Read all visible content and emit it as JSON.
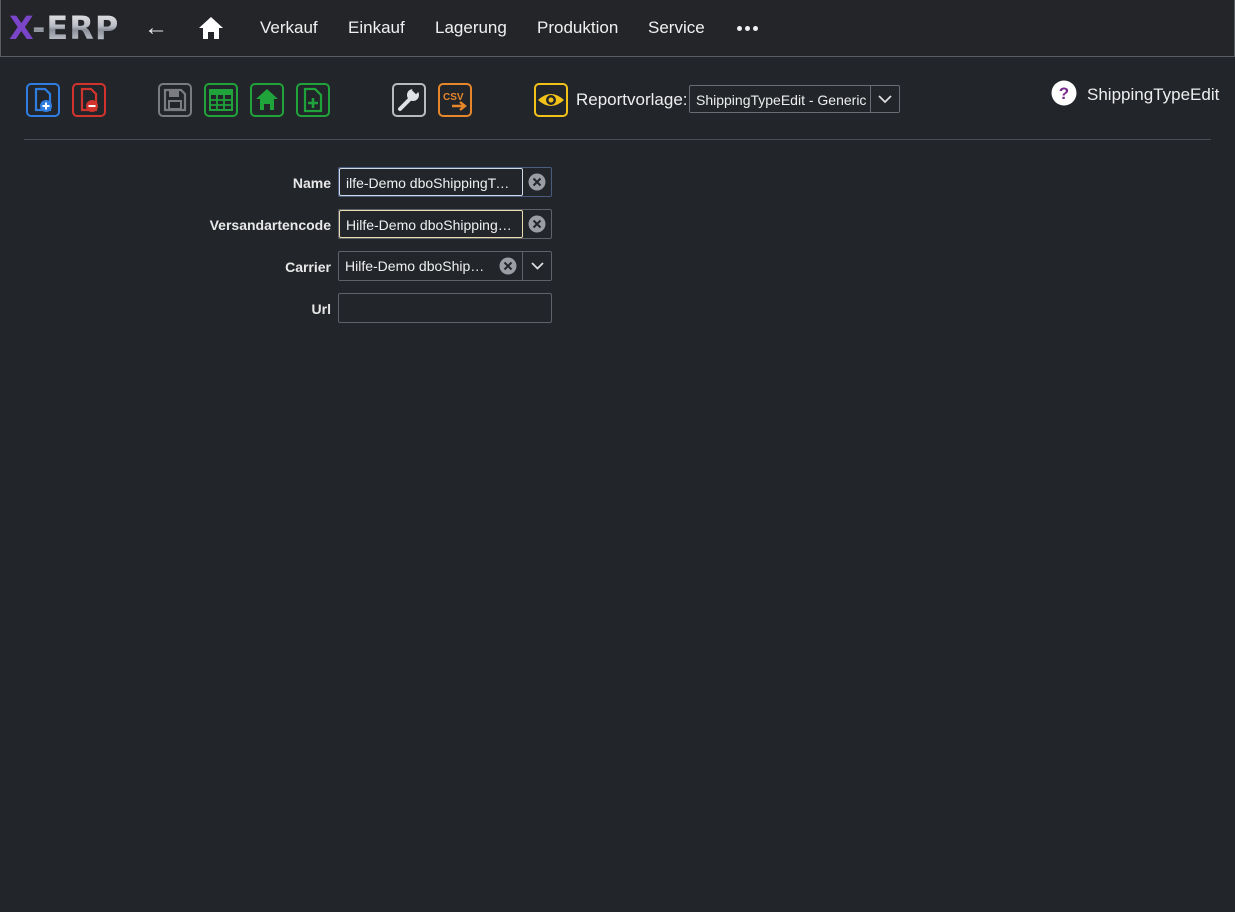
{
  "app": {
    "logo_x": "X",
    "logo_rest": "-ERP",
    "back_glyph": "←"
  },
  "nav": {
    "items": [
      "Verkauf",
      "Einkauf",
      "Lagerung",
      "Produktion",
      "Service"
    ]
  },
  "toolbar": {
    "buttons": [
      {
        "name": "new-document-button",
        "icon": "file-plus-icon",
        "color": "#2f7de1"
      },
      {
        "name": "delete-document-button",
        "icon": "file-minus-icon",
        "color": "#d0342c"
      },
      {
        "name": "save-button",
        "icon": "save-icon",
        "color": "#7a7c80"
      },
      {
        "name": "table-view-button",
        "icon": "table-icon",
        "color": "#1fa33a"
      },
      {
        "name": "home-record-button",
        "icon": "home-icon",
        "color": "#1fa33a"
      },
      {
        "name": "add-document-button",
        "icon": "file-plus-icon",
        "color": "#1fa33a"
      },
      {
        "name": "settings-button",
        "icon": "wrench-icon",
        "color": "#b8bbc0"
      },
      {
        "name": "csv-export-button",
        "icon": "csv-icon",
        "color": "#e8862a"
      },
      {
        "name": "preview-button",
        "icon": "eye-icon",
        "color": "#f3c21a"
      }
    ],
    "csv_text": "CSV",
    "report_label": "Reportvorlage:",
    "report_value": "ShippingTypeEdit - Generic",
    "help_glyph": "?",
    "page_title": "ShippingTypeEdit"
  },
  "form": {
    "name_label": "Name",
    "name_value": "ilfe-Demo dboShippingType",
    "code_label": "Versandartencode",
    "code_value": "Hilfe-Demo dboShippingType",
    "carrier_label": "Carrier",
    "carrier_value": "Hilfe-Demo dboShippingCarrier",
    "url_label": "Url",
    "url_value": ""
  },
  "colors": {
    "background": "#22252a",
    "focus_border": "#cfd8e6",
    "active_border": "#e9dcae",
    "accent_blue": "#2f7de1",
    "accent_red": "#d0342c",
    "accent_green": "#1fa33a",
    "accent_orange": "#e8862a",
    "accent_yellow": "#f3c21a",
    "help_purple": "#7a2a8c"
  }
}
